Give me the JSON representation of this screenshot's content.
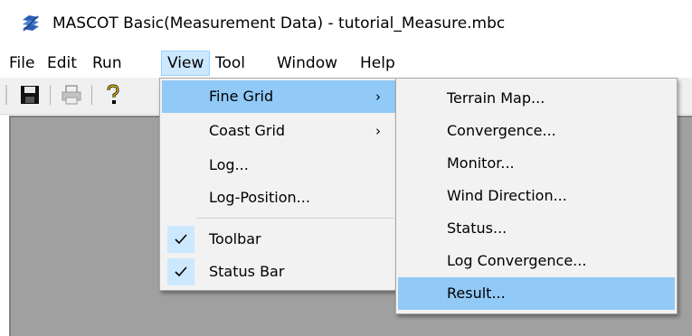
{
  "window": {
    "title": "MASCOT Basic(Measurement Data) - tutorial_Measure.mbc",
    "icon": "mascot-app-icon"
  },
  "menubar": {
    "items": [
      {
        "label": "File"
      },
      {
        "label": "Edit"
      },
      {
        "label": "Run"
      },
      {
        "label": "View",
        "active": true
      },
      {
        "label": "Tool"
      },
      {
        "label": "Window"
      },
      {
        "label": "Help"
      }
    ]
  },
  "toolbar": {
    "buttons": [
      "save-icon",
      "print-icon",
      "help-icon"
    ]
  },
  "view_menu": {
    "items": [
      {
        "label": "Fine Grid",
        "submenu_arrow": "›",
        "highlighted": true
      },
      {
        "label": "Coast Grid",
        "submenu_arrow": "›"
      },
      {
        "label": "Log..."
      },
      {
        "label": "Log-Position..."
      },
      {
        "label": "Toolbar",
        "checked": true,
        "check_glyph": "✓"
      },
      {
        "label": "Status Bar",
        "checked": true,
        "check_glyph": "✓"
      }
    ]
  },
  "fine_grid_submenu": {
    "items": [
      {
        "label": "Terrain Map..."
      },
      {
        "label": "Convergence..."
      },
      {
        "label": "Monitor..."
      },
      {
        "label": "Wind Direction..."
      },
      {
        "label": "Status..."
      },
      {
        "label": "Log Convergence..."
      },
      {
        "label": "Result...",
        "highlighted": true
      }
    ]
  },
  "colors": {
    "menu_highlight": "#91c9f7",
    "menubar_active": "#cce8ff",
    "client_area": "#a0a0a0",
    "menu_background": "#f2f2f2"
  }
}
